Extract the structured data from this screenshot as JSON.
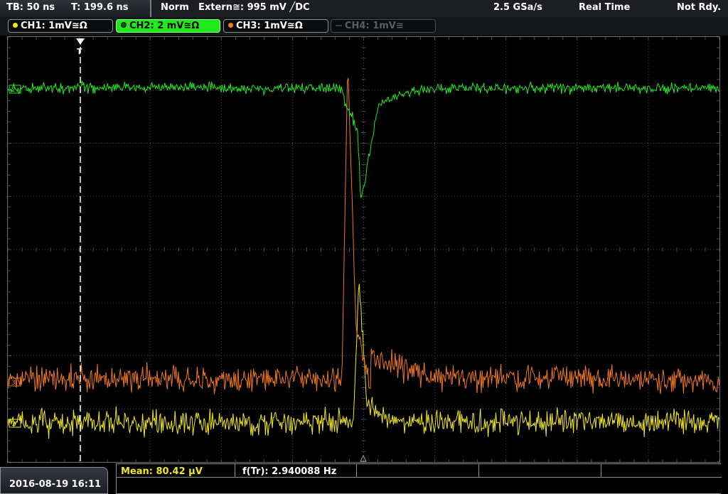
{
  "header": {
    "timebase": "TB: 50 ns",
    "trigger_time": "T: 199.6 ns",
    "mode": "Norm",
    "trigger_source": "Extern≅: 995 mV ╱DC",
    "sample_rate": "2.5 GSa/s",
    "acq_mode": "Real Time",
    "status": "Not Rdy."
  },
  "channels": [
    {
      "label": "CH1: 1mV≅Ω",
      "color": "#f2e81a",
      "state": "on"
    },
    {
      "label": "CH2: 2 mV≅Ω",
      "color": "#22e81e",
      "state": "selected"
    },
    {
      "label": "CH3: 1mV≅Ω",
      "color": "#f07820",
      "state": "on"
    },
    {
      "label": "CH4: 1mV≅",
      "color": "#5b5d61",
      "state": "off"
    }
  ],
  "markers": {
    "ch2": "2",
    "ch3": "3",
    "ch1": "1",
    "trigger": "T"
  },
  "footer": {
    "datetime": "2016-08-19 16:11",
    "mean": "Mean: 80.42 µV",
    "freq": "f(Tr): 2.940088 Hz"
  },
  "colors": {
    "ch1": "#f2e81a",
    "ch2": "#22e81e",
    "ch3": "#f07820",
    "grid": "#4a4c50",
    "mean_text": "#f2e81a"
  }
}
